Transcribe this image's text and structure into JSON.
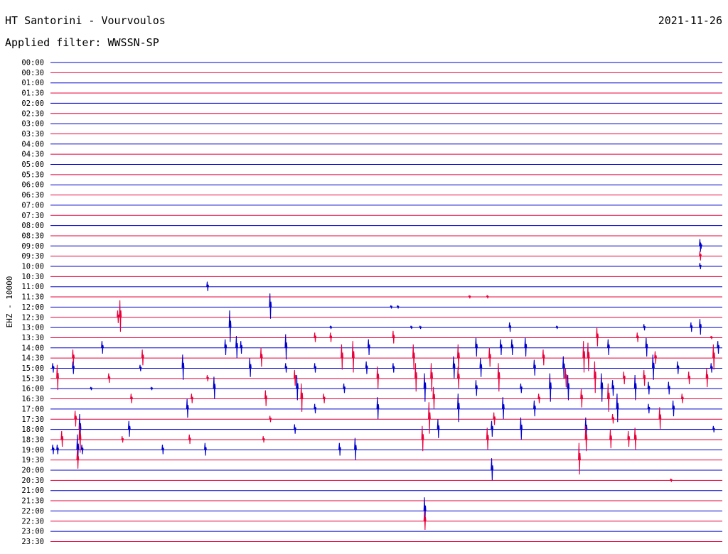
{
  "header": {
    "station": "HT Santorini - Vourvoulos",
    "date": "2021-11-26",
    "filter_label": "Applied filter: ",
    "filter_value": "WWSSN-SP"
  },
  "colors": {
    "blue": "#0000cc",
    "red": "#e8003a"
  },
  "chart_data": {
    "type": "line",
    "ylabel": "EHZ - 10000",
    "rows": [
      "00:00",
      "00:30",
      "01:00",
      "01:30",
      "02:00",
      "02:30",
      "03:00",
      "03:30",
      "04:00",
      "04:30",
      "05:00",
      "05:30",
      "06:00",
      "06:30",
      "07:00",
      "07:30",
      "08:00",
      "08:30",
      "09:00",
      "09:30",
      "10:00",
      "10:30",
      "11:00",
      "11:30",
      "12:00",
      "12:30",
      "13:00",
      "13:30",
      "14:00",
      "14:30",
      "15:00",
      "15:30",
      "16:00",
      "16:30",
      "17:00",
      "17:30",
      "18:00",
      "18:30",
      "19:00",
      "19:30",
      "20:00",
      "20:30",
      "21:00",
      "21:30",
      "22:00",
      "22:30",
      "23:00",
      "23:30"
    ],
    "row_colors": [
      "blue",
      "red"
    ],
    "x_range": [
      0,
      30
    ],
    "events": [
      {
        "row": 18,
        "t": 29.0,
        "amp": 0.4
      },
      {
        "row": 18,
        "t": 29.03,
        "amp": 0.2
      },
      {
        "row": 19,
        "t": 29.0,
        "amp": 0.3
      },
      {
        "row": 20,
        "t": 29.0,
        "amp": 0.2
      },
      {
        "row": 22,
        "t": 7.0,
        "amp": 0.3
      },
      {
        "row": 23,
        "t": 18.7,
        "amp": 0.1
      },
      {
        "row": 23,
        "t": 19.5,
        "amp": 0.1
      },
      {
        "row": 24,
        "t": 9.8,
        "amp": 0.8
      },
      {
        "row": 24,
        "t": 15.2,
        "amp": 0.1
      },
      {
        "row": 24,
        "t": 15.5,
        "amp": 0.1
      },
      {
        "row": 25,
        "t": 3.0,
        "amp": 0.4
      },
      {
        "row": 25,
        "t": 3.1,
        "amp": 1.0
      },
      {
        "row": 26,
        "t": 8.0,
        "amp": 1.0
      },
      {
        "row": 26,
        "t": 12.5,
        "amp": 0.1
      },
      {
        "row": 26,
        "t": 16.1,
        "amp": 0.1
      },
      {
        "row": 26,
        "t": 16.5,
        "amp": 0.1
      },
      {
        "row": 26,
        "t": 20.5,
        "amp": 0.3
      },
      {
        "row": 26,
        "t": 22.6,
        "amp": 0.1
      },
      {
        "row": 26,
        "t": 26.5,
        "amp": 0.2
      },
      {
        "row": 26,
        "t": 28.6,
        "amp": 0.3
      },
      {
        "row": 26,
        "t": 29.0,
        "amp": 0.5
      },
      {
        "row": 27,
        "t": 11.8,
        "amp": 0.3
      },
      {
        "row": 27,
        "t": 12.5,
        "amp": 0.3
      },
      {
        "row": 27,
        "t": 15.3,
        "amp": 0.4
      },
      {
        "row": 27,
        "t": 24.4,
        "amp": 0.6
      },
      {
        "row": 27,
        "t": 26.2,
        "amp": 0.3
      },
      {
        "row": 27,
        "t": 29.5,
        "amp": 0.1
      },
      {
        "row": 28,
        "t": 2.3,
        "amp": 0.4
      },
      {
        "row": 28,
        "t": 7.8,
        "amp": 0.5
      },
      {
        "row": 28,
        "t": 8.3,
        "amp": 0.7
      },
      {
        "row": 28,
        "t": 8.5,
        "amp": 0.4
      },
      {
        "row": 28,
        "t": 10.5,
        "amp": 0.8
      },
      {
        "row": 28,
        "t": 14.2,
        "amp": 0.5
      },
      {
        "row": 28,
        "t": 19.0,
        "amp": 0.6
      },
      {
        "row": 28,
        "t": 20.1,
        "amp": 0.5
      },
      {
        "row": 28,
        "t": 20.6,
        "amp": 0.5
      },
      {
        "row": 28,
        "t": 21.2,
        "amp": 0.6
      },
      {
        "row": 28,
        "t": 24.9,
        "amp": 0.5
      },
      {
        "row": 28,
        "t": 26.6,
        "amp": 0.6
      },
      {
        "row": 28,
        "t": 29.8,
        "amp": 0.4
      },
      {
        "row": 29,
        "t": 1.0,
        "amp": 0.5
      },
      {
        "row": 29,
        "t": 4.1,
        "amp": 0.5
      },
      {
        "row": 29,
        "t": 9.4,
        "amp": 0.6
      },
      {
        "row": 29,
        "t": 13.0,
        "amp": 0.8
      },
      {
        "row": 29,
        "t": 13.5,
        "amp": 1.0
      },
      {
        "row": 29,
        "t": 16.2,
        "amp": 0.8
      },
      {
        "row": 29,
        "t": 18.2,
        "amp": 0.8
      },
      {
        "row": 29,
        "t": 19.6,
        "amp": 0.6
      },
      {
        "row": 29,
        "t": 22.0,
        "amp": 0.5
      },
      {
        "row": 29,
        "t": 23.8,
        "amp": 1.0
      },
      {
        "row": 29,
        "t": 24.0,
        "amp": 0.9
      },
      {
        "row": 29,
        "t": 27.0,
        "amp": 0.4
      },
      {
        "row": 29,
        "t": 29.6,
        "amp": 0.8
      },
      {
        "row": 30,
        "t": 0.1,
        "amp": 0.3
      },
      {
        "row": 30,
        "t": 1.0,
        "amp": 0.4
      },
      {
        "row": 30,
        "t": 4.0,
        "amp": 0.2
      },
      {
        "row": 30,
        "t": 5.9,
        "amp": 0.8
      },
      {
        "row": 30,
        "t": 8.9,
        "amp": 0.6
      },
      {
        "row": 30,
        "t": 10.5,
        "amp": 0.3
      },
      {
        "row": 30,
        "t": 11.8,
        "amp": 0.3
      },
      {
        "row": 30,
        "t": 14.1,
        "amp": 0.4
      },
      {
        "row": 30,
        "t": 15.3,
        "amp": 0.3
      },
      {
        "row": 30,
        "t": 18.0,
        "amp": 0.7
      },
      {
        "row": 30,
        "t": 19.2,
        "amp": 0.6
      },
      {
        "row": 30,
        "t": 21.6,
        "amp": 0.5
      },
      {
        "row": 30,
        "t": 22.9,
        "amp": 0.7
      },
      {
        "row": 30,
        "t": 26.9,
        "amp": 0.8
      },
      {
        "row": 30,
        "t": 28.0,
        "amp": 0.4
      },
      {
        "row": 30,
        "t": 29.5,
        "amp": 0.3
      },
      {
        "row": 31,
        "t": 0.3,
        "amp": 0.8
      },
      {
        "row": 31,
        "t": 2.6,
        "amp": 0.3
      },
      {
        "row": 31,
        "t": 7.0,
        "amp": 0.2
      },
      {
        "row": 31,
        "t": 10.9,
        "amp": 0.5
      },
      {
        "row": 31,
        "t": 14.6,
        "amp": 0.7
      },
      {
        "row": 31,
        "t": 16.3,
        "amp": 0.9
      },
      {
        "row": 31,
        "t": 17.0,
        "amp": 0.9
      },
      {
        "row": 31,
        "t": 18.2,
        "amp": 0.7
      },
      {
        "row": 31,
        "t": 20.0,
        "amp": 0.9
      },
      {
        "row": 31,
        "t": 23.0,
        "amp": 0.6
      },
      {
        "row": 31,
        "t": 24.3,
        "amp": 1.0
      },
      {
        "row": 31,
        "t": 25.6,
        "amp": 0.4
      },
      {
        "row": 31,
        "t": 26.5,
        "amp": 0.5
      },
      {
        "row": 31,
        "t": 28.5,
        "amp": 0.4
      },
      {
        "row": 31,
        "t": 29.3,
        "amp": 0.6
      },
      {
        "row": 32,
        "t": 1.8,
        "amp": 0.1
      },
      {
        "row": 32,
        "t": 4.5,
        "amp": 0.1
      },
      {
        "row": 32,
        "t": 7.3,
        "amp": 0.7
      },
      {
        "row": 32,
        "t": 11.0,
        "amp": 0.8
      },
      {
        "row": 32,
        "t": 13.1,
        "amp": 0.3
      },
      {
        "row": 32,
        "t": 16.7,
        "amp": 0.9
      },
      {
        "row": 32,
        "t": 19.0,
        "amp": 0.5
      },
      {
        "row": 32,
        "t": 21.0,
        "amp": 0.3
      },
      {
        "row": 32,
        "t": 22.3,
        "amp": 0.9
      },
      {
        "row": 32,
        "t": 23.1,
        "amp": 0.8
      },
      {
        "row": 32,
        "t": 24.6,
        "amp": 0.9
      },
      {
        "row": 32,
        "t": 25.1,
        "amp": 0.5
      },
      {
        "row": 32,
        "t": 26.1,
        "amp": 0.8
      },
      {
        "row": 32,
        "t": 26.7,
        "amp": 0.4
      },
      {
        "row": 32,
        "t": 27.6,
        "amp": 0.4
      },
      {
        "row": 33,
        "t": 3.6,
        "amp": 0.3
      },
      {
        "row": 33,
        "t": 6.3,
        "amp": 0.3
      },
      {
        "row": 33,
        "t": 9.6,
        "amp": 0.5
      },
      {
        "row": 33,
        "t": 11.2,
        "amp": 0.9
      },
      {
        "row": 33,
        "t": 12.2,
        "amp": 0.3
      },
      {
        "row": 33,
        "t": 17.1,
        "amp": 0.7
      },
      {
        "row": 33,
        "t": 21.8,
        "amp": 0.3
      },
      {
        "row": 33,
        "t": 23.7,
        "amp": 0.6
      },
      {
        "row": 33,
        "t": 24.9,
        "amp": 0.9
      },
      {
        "row": 33,
        "t": 28.2,
        "amp": 0.3
      },
      {
        "row": 34,
        "t": 6.1,
        "amp": 0.6
      },
      {
        "row": 34,
        "t": 11.8,
        "amp": 0.3
      },
      {
        "row": 34,
        "t": 14.6,
        "amp": 0.7
      },
      {
        "row": 34,
        "t": 18.2,
        "amp": 0.9
      },
      {
        "row": 34,
        "t": 20.2,
        "amp": 0.7
      },
      {
        "row": 34,
        "t": 21.6,
        "amp": 0.5
      },
      {
        "row": 34,
        "t": 25.3,
        "amp": 0.9
      },
      {
        "row": 34,
        "t": 26.7,
        "amp": 0.3
      },
      {
        "row": 34,
        "t": 27.8,
        "amp": 0.5
      },
      {
        "row": 35,
        "t": 1.1,
        "amp": 0.5
      },
      {
        "row": 35,
        "t": 9.8,
        "amp": 0.2
      },
      {
        "row": 35,
        "t": 16.9,
        "amp": 1.0
      },
      {
        "row": 35,
        "t": 19.8,
        "amp": 0.4
      },
      {
        "row": 35,
        "t": 25.1,
        "amp": 0.3
      },
      {
        "row": 35,
        "t": 27.2,
        "amp": 0.7
      },
      {
        "row": 36,
        "t": 1.3,
        "amp": 0.9
      },
      {
        "row": 36,
        "t": 3.5,
        "amp": 0.5
      },
      {
        "row": 36,
        "t": 10.9,
        "amp": 0.3
      },
      {
        "row": 36,
        "t": 17.3,
        "amp": 0.6
      },
      {
        "row": 36,
        "t": 19.7,
        "amp": 0.5
      },
      {
        "row": 36,
        "t": 21.0,
        "amp": 0.7
      },
      {
        "row": 36,
        "t": 23.9,
        "amp": 0.7
      },
      {
        "row": 36,
        "t": 29.6,
        "amp": 0.2
      },
      {
        "row": 37,
        "t": 0.5,
        "amp": 0.5
      },
      {
        "row": 37,
        "t": 1.3,
        "amp": 0.9
      },
      {
        "row": 37,
        "t": 3.2,
        "amp": 0.2
      },
      {
        "row": 37,
        "t": 6.2,
        "amp": 0.3
      },
      {
        "row": 37,
        "t": 9.5,
        "amp": 0.2
      },
      {
        "row": 37,
        "t": 16.6,
        "amp": 0.8
      },
      {
        "row": 37,
        "t": 19.5,
        "amp": 0.7
      },
      {
        "row": 37,
        "t": 23.9,
        "amp": 0.8
      },
      {
        "row": 37,
        "t": 25.0,
        "amp": 0.6
      },
      {
        "row": 37,
        "t": 25.8,
        "amp": 0.5
      },
      {
        "row": 37,
        "t": 26.1,
        "amp": 0.7
      },
      {
        "row": 38,
        "t": 0.1,
        "amp": 0.3
      },
      {
        "row": 38,
        "t": 0.3,
        "amp": 0.3
      },
      {
        "row": 38,
        "t": 1.2,
        "amp": 0.9
      },
      {
        "row": 38,
        "t": 1.4,
        "amp": 0.3
      },
      {
        "row": 38,
        "t": 5.0,
        "amp": 0.3
      },
      {
        "row": 38,
        "t": 6.9,
        "amp": 0.4
      },
      {
        "row": 38,
        "t": 12.9,
        "amp": 0.4
      },
      {
        "row": 38,
        "t": 13.6,
        "amp": 0.7
      },
      {
        "row": 39,
        "t": 1.2,
        "amp": 0.6
      },
      {
        "row": 39,
        "t": 23.6,
        "amp": 1.0
      },
      {
        "row": 40,
        "t": 19.7,
        "amp": 0.7
      },
      {
        "row": 41,
        "t": 27.7,
        "amp": 0.1
      },
      {
        "row": 44,
        "t": 16.7,
        "amp": 0.8
      },
      {
        "row": 45,
        "t": 16.7,
        "amp": 0.6
      }
    ]
  }
}
